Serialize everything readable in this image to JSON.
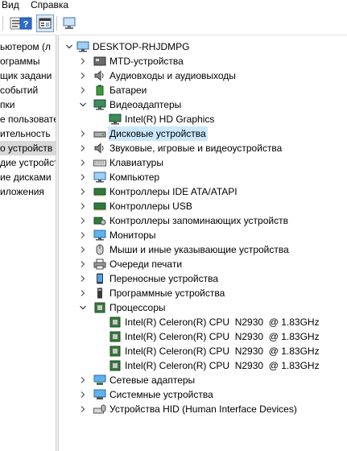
{
  "menu": {
    "view": "Вид",
    "help": "Справка"
  },
  "left_pane": [
    "ьютером (л",
    "ограммы",
    "щик задани",
    "событий",
    "пки",
    "е пользовате",
    "ительность",
    "о устройств",
    "дие устройст",
    "ие дисками",
    "иложения"
  ],
  "tree": {
    "root": "DESKTOP-RHJDMPG",
    "items": [
      {
        "label": "MTD-устройства",
        "icon": "mtd-icon",
        "expanded": false
      },
      {
        "label": "Аудиовходы и аудиовыходы",
        "icon": "speaker-icon",
        "expanded": false
      },
      {
        "label": "Батареи",
        "icon": "battery-icon",
        "expanded": false
      },
      {
        "label": "Видеоадаптеры",
        "icon": "monitor-icon",
        "expanded": true,
        "children": [
          "Intel(R) HD Graphics"
        ]
      },
      {
        "label": "Дисковые устройства",
        "icon": "disk-icon",
        "expanded": false,
        "selected": true
      },
      {
        "label": "Звуковые, игровые и видеоустройства",
        "icon": "speaker-icon",
        "expanded": false
      },
      {
        "label": "Клавиатуры",
        "icon": "keyboard-icon",
        "expanded": false
      },
      {
        "label": "Компьютер",
        "icon": "computer-icon",
        "expanded": false
      },
      {
        "label": "Контроллеры IDE ATA/ATAPI",
        "icon": "controller-icon",
        "expanded": false
      },
      {
        "label": "Контроллеры USB",
        "icon": "usb-icon",
        "expanded": false
      },
      {
        "label": "Контроллеры запоминающих устройств",
        "icon": "storage-controller-icon",
        "expanded": false
      },
      {
        "label": "Мониторы",
        "icon": "monitor-icon",
        "expanded": false
      },
      {
        "label": "Мыши и иные указывающие устройства",
        "icon": "mouse-icon",
        "expanded": false
      },
      {
        "label": "Очереди печати",
        "icon": "printer-icon",
        "expanded": false
      },
      {
        "label": "Переносные устройства",
        "icon": "portable-icon",
        "expanded": false
      },
      {
        "label": "Программные устройства",
        "icon": "software-device-icon",
        "expanded": false
      },
      {
        "label": "Процессоры",
        "icon": "cpu-icon",
        "expanded": true,
        "children": [
          "Intel(R) Celeron(R) CPU  N2930  @ 1.83GHz",
          "Intel(R) Celeron(R) CPU  N2930  @ 1.83GHz",
          "Intel(R) Celeron(R) CPU  N2930  @ 1.83GHz",
          "Intel(R) Celeron(R) CPU  N2930  @ 1.83GHz"
        ]
      },
      {
        "label": "Сетевые адаптеры",
        "icon": "network-icon",
        "expanded": false
      },
      {
        "label": "Системные устройства",
        "icon": "system-icon",
        "expanded": false
      },
      {
        "label": "Устройства HID (Human Interface Devices)",
        "icon": "hid-icon",
        "expanded": false
      }
    ]
  },
  "colors": {
    "selection": "#cce8ff",
    "accent": "#1f6fbf",
    "chip": "#3b7a3b"
  }
}
